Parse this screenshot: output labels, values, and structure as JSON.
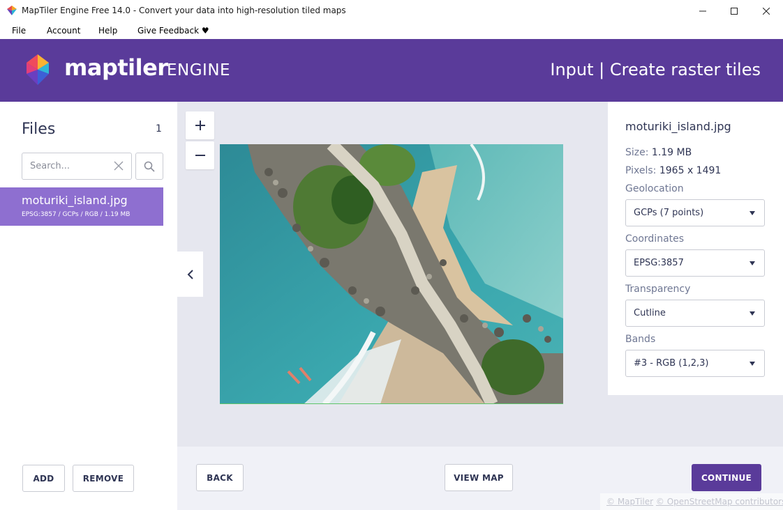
{
  "window": {
    "title": "MapTiler Engine Free 14.0 - Convert your data into high-resolution tiled maps"
  },
  "menu": {
    "file": "File",
    "account": "Account",
    "help": "Help",
    "feedback": "Give Feedback ♥"
  },
  "header": {
    "logo_bold": "maptiler",
    "logo_light": "ENGINE",
    "step": "Input | Create raster tiles"
  },
  "sidebar": {
    "title": "Files",
    "count": "1",
    "search_placeholder": "Search...",
    "files": [
      {
        "name": "moturiki_island.jpg",
        "meta": "EPSG:3857 / GCPs / RGB / 1.19 MB",
        "selected": true
      }
    ],
    "add_label": "ADD",
    "remove_label": "REMOVE"
  },
  "map": {
    "zoom_in": "+",
    "zoom_out": "−",
    "collapse_icon": "chevron-left-icon"
  },
  "properties": {
    "filename": "moturiki_island.jpg",
    "size_label": "Size:",
    "size_value": "1.19 MB",
    "pixels_label": "Pixels:",
    "pixels_value": "1965 x 1491",
    "geolocation_label": "Geolocation",
    "geolocation_value": "GCPs (7 points)",
    "coordinates_label": "Coordinates",
    "coordinates_value": "EPSG:3857",
    "transparency_label": "Transparency",
    "transparency_value": "Cutline",
    "bands_label": "Bands",
    "bands_value": "#3 - RGB (1,2,3)"
  },
  "footer": {
    "back_label": "BACK",
    "viewmap_label": "VIEW MAP",
    "continue_label": "CONTINUE",
    "attribution_maptiler": "© MapTiler",
    "attribution_osm": "© OpenStreetMap contributors"
  },
  "colors": {
    "brand_purple": "#5a3b9a",
    "selected_item": "#8e6fd0",
    "workspace_bg": "#e6e7ef"
  }
}
